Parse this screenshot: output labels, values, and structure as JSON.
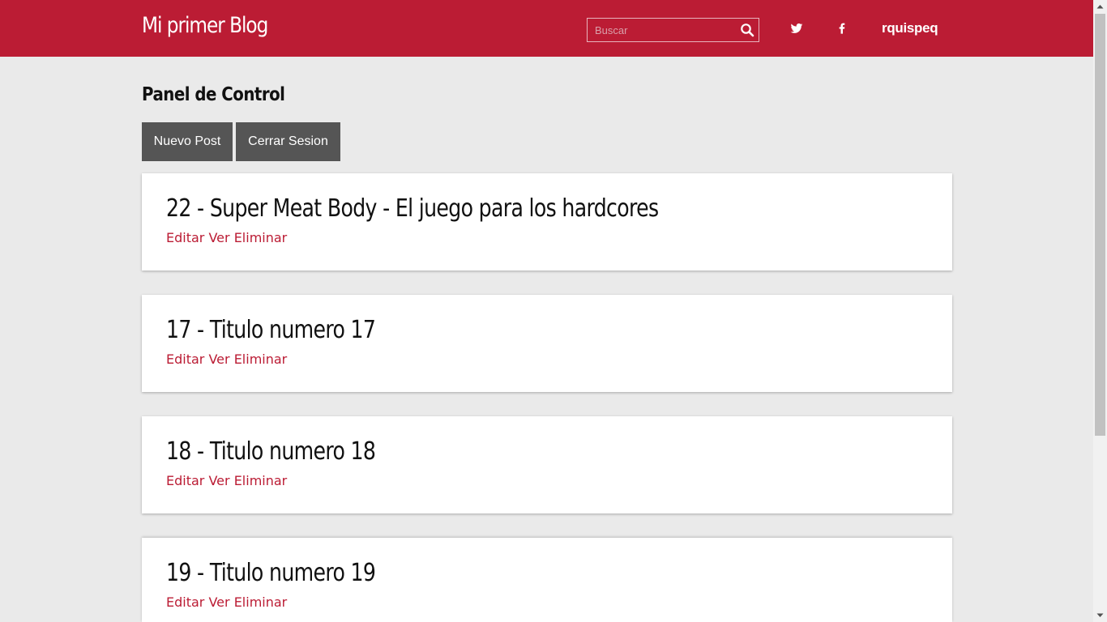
{
  "header": {
    "brand": "Mi primer Blog",
    "search_placeholder": "Buscar",
    "search_icon": "search-icon",
    "twitter_icon": "twitter-icon",
    "facebook_icon": "facebook-icon",
    "username": "rquispeq"
  },
  "panel": {
    "title": "Panel de Control",
    "new_post_label": "Nuevo Post",
    "logout_label": "Cerrar Sesion"
  },
  "posts": [
    {
      "title": "22 - Super Meat Body - El juego para los hardcores",
      "edit": "Editar",
      "view": "Ver",
      "delete": "Eliminar"
    },
    {
      "title": "17 - Titulo numero 17",
      "edit": "Editar",
      "view": "Ver",
      "delete": "Eliminar"
    },
    {
      "title": "18 - Titulo numero 18",
      "edit": "Editar",
      "view": "Ver",
      "delete": "Eliminar"
    },
    {
      "title": "19 - Titulo numero 19",
      "edit": "Editar",
      "view": "Ver",
      "delete": "Eliminar"
    }
  ],
  "colors": {
    "brand": "#bb1c34",
    "background": "#eaeaea",
    "button": "#555555",
    "link": "#bb1c34"
  }
}
